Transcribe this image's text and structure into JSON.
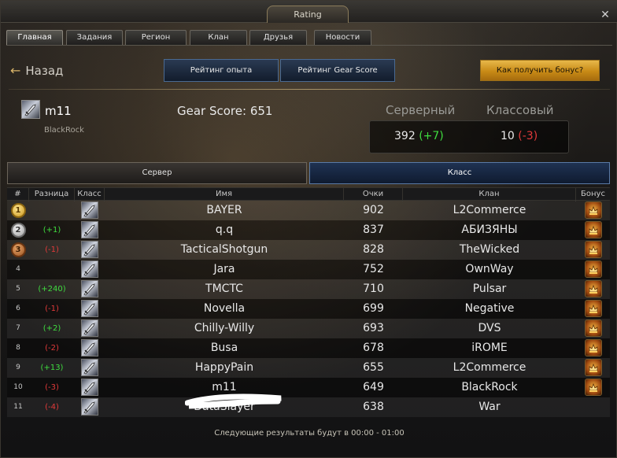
{
  "window": {
    "title": "Rating"
  },
  "tabs": [
    {
      "label": "Главная",
      "active": true
    },
    {
      "label": "Задания",
      "active": false
    },
    {
      "label": "Регион",
      "active": false
    },
    {
      "label": "Клан",
      "active": false
    },
    {
      "label": "Друзья",
      "active": false
    },
    {
      "label": "Новости",
      "active": false
    }
  ],
  "toolbar": {
    "back_label": "Назад",
    "exp_rating_label": "Рейтинг опыта",
    "gear_rating_label": "Рейтинг Gear Score",
    "bonus_label": "Как получить бонус?"
  },
  "character": {
    "name": "m11",
    "clan": "BlackRock",
    "gear_score_label": "Gear Score: 651"
  },
  "ranks": {
    "server_label": "Серверный",
    "class_label": "Классовый",
    "server_value": "392",
    "server_delta": "(+7)",
    "class_value": "10",
    "class_delta": "(-3)"
  },
  "segments": {
    "server_label": "Сервер",
    "class_label": "Класс",
    "active": "class"
  },
  "table": {
    "headers": {
      "rank": "#",
      "diff": "Разница",
      "cls": "Класс",
      "name": "Имя",
      "score": "Очки",
      "clan": "Клан",
      "bonus": "Бонус"
    },
    "rows": [
      {
        "rank": "1",
        "medal": "gold",
        "diff": "",
        "diff_type": "none",
        "name": "BAYER",
        "score": "902",
        "clan": "L2Commerce",
        "bonus": true
      },
      {
        "rank": "2",
        "medal": "silver",
        "diff": "(+1)",
        "diff_type": "pos",
        "name": "q.q",
        "score": "837",
        "clan": "АБИЗЯНЫ",
        "bonus": true
      },
      {
        "rank": "3",
        "medal": "bronze",
        "diff": "(-1)",
        "diff_type": "neg",
        "name": "TacticalShotgun",
        "score": "828",
        "clan": "TheWicked",
        "bonus": true
      },
      {
        "rank": "4",
        "medal": "",
        "diff": "",
        "diff_type": "none",
        "name": "Jara",
        "score": "752",
        "clan": "OwnWay",
        "bonus": true
      },
      {
        "rank": "5",
        "medal": "",
        "diff": "(+240)",
        "diff_type": "pos",
        "name": "TMCTC",
        "score": "710",
        "clan": "Pulsar",
        "bonus": true
      },
      {
        "rank": "6",
        "medal": "",
        "diff": "(-1)",
        "diff_type": "neg",
        "name": "Novella",
        "score": "699",
        "clan": "Negative",
        "bonus": true
      },
      {
        "rank": "7",
        "medal": "",
        "diff": "(+2)",
        "diff_type": "pos",
        "name": "Chilly-Willy",
        "score": "693",
        "clan": "DVS",
        "bonus": true
      },
      {
        "rank": "8",
        "medal": "",
        "diff": "(-2)",
        "diff_type": "neg",
        "name": "Busa",
        "score": "678",
        "clan": "iROME",
        "bonus": true
      },
      {
        "rank": "9",
        "medal": "",
        "diff": "(+13)",
        "diff_type": "pos",
        "name": "HappyPain",
        "score": "655",
        "clan": "L2Commerce",
        "bonus": true
      },
      {
        "rank": "10",
        "medal": "",
        "diff": "(-3)",
        "diff_type": "neg",
        "name": "m11",
        "score": "649",
        "clan": "BlackRock",
        "bonus": true
      },
      {
        "rank": "11",
        "medal": "",
        "diff": "(-4)",
        "diff_type": "neg",
        "name": "DataSlayer",
        "score": "638",
        "clan": "War",
        "bonus": false
      }
    ]
  },
  "footer": {
    "text": "Следующие результаты будут в 00:00 - 01:00"
  },
  "colors": {
    "positive": "#3fdc3f",
    "negative": "#e23a3a",
    "gold_button": "#d89a26",
    "blue_button": "#1f3252"
  },
  "icons": {
    "class_icon": "dagger-class-icon",
    "bonus_icon": "bonus-chest-icon",
    "back_icon": "arrow-left-icon",
    "close_icon": "close-icon"
  }
}
